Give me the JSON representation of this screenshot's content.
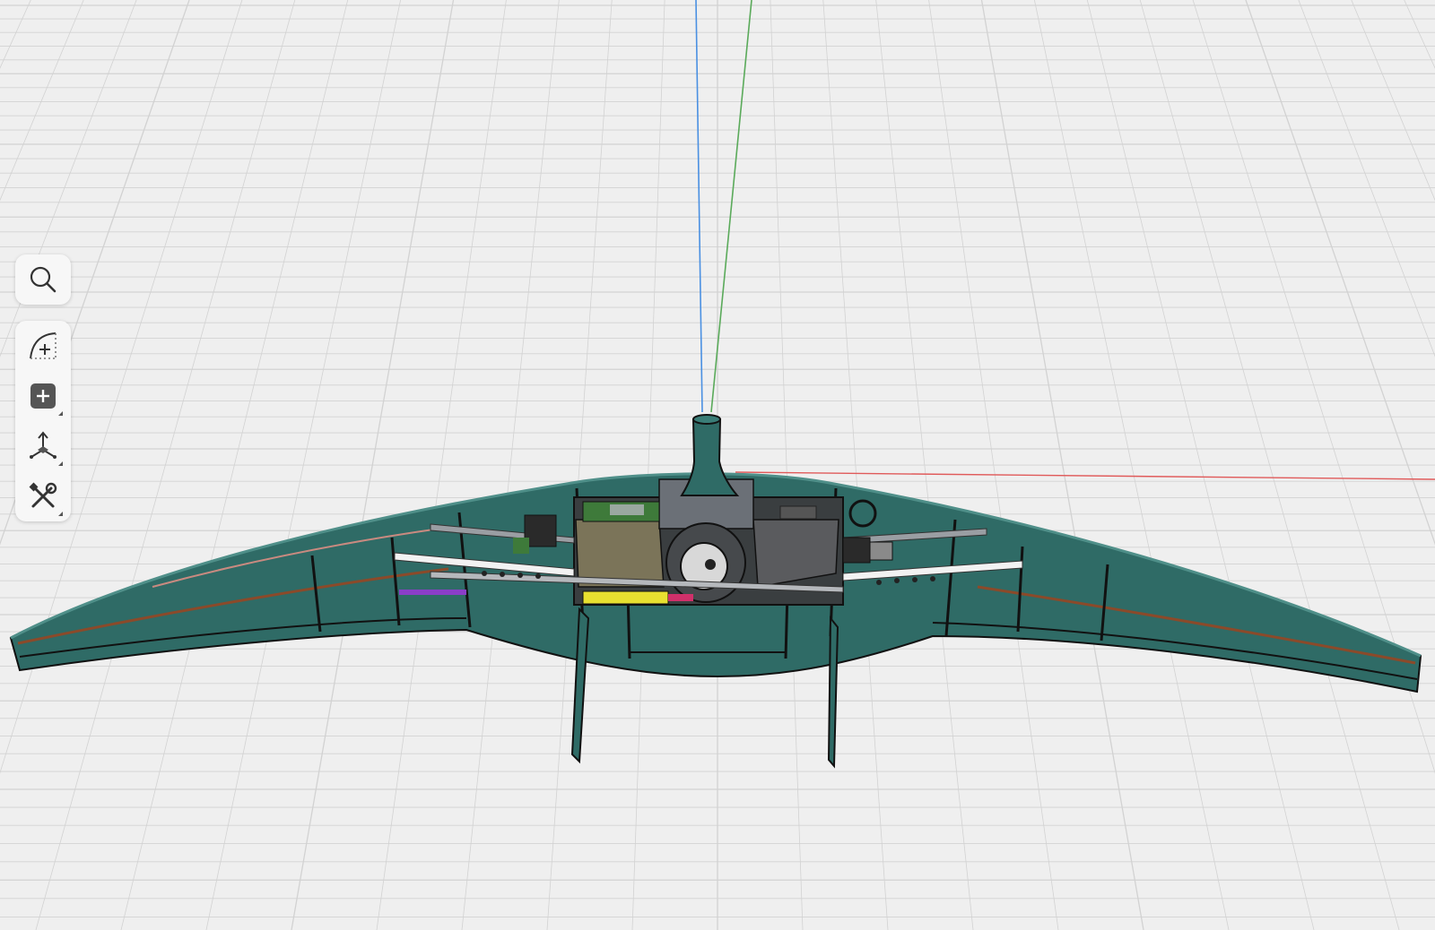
{
  "viewport": {
    "background": "#efefef",
    "grid_color": "#d2d2d2",
    "axis_colors": {
      "x": "#e05a5a",
      "y": "#5aaa5a",
      "z": "#4a90e2"
    },
    "model_color": "#2f6b66",
    "model_edge_color": "#111111"
  },
  "toolbar": {
    "search": {
      "icon": "search-icon"
    },
    "tools": [
      {
        "icon": "sketch-curve-icon"
      },
      {
        "icon": "add-primitive-icon",
        "has_menu": true
      },
      {
        "icon": "transform-gizmo-icon",
        "has_menu": true
      },
      {
        "icon": "tools-wrench-icon",
        "has_menu": true
      }
    ]
  }
}
